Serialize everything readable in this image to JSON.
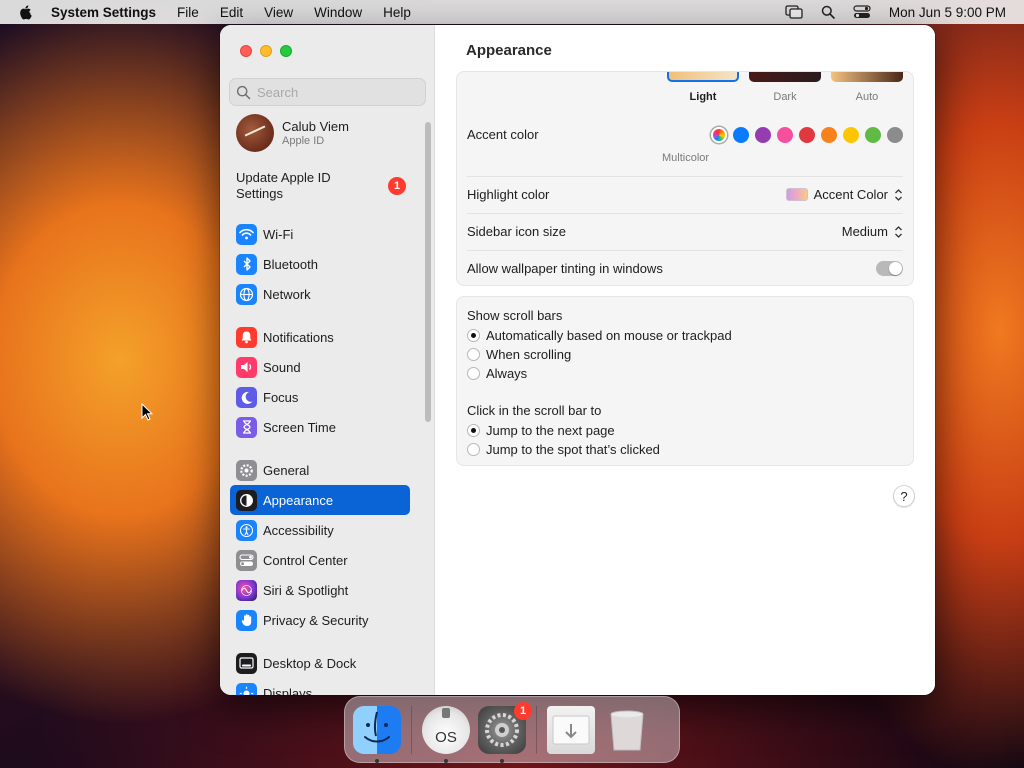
{
  "menubar": {
    "app_name": "System Settings",
    "menus": [
      "File",
      "Edit",
      "View",
      "Window",
      "Help"
    ],
    "icons": [
      "screen-mirroring-icon",
      "spotlight-search-icon",
      "control-center-icon"
    ],
    "clock": "Mon Jun 5  9:00 PM"
  },
  "sidebar": {
    "search_placeholder": "Search",
    "account": {
      "name": "Calub Viem",
      "subtitle": "Apple ID"
    },
    "update": {
      "label": "Update Apple ID Settings",
      "badge": "1"
    },
    "items": [
      {
        "label": "Wi-Fi",
        "icon": "wifi-icon",
        "color": "#1a84ff"
      },
      {
        "label": "Bluetooth",
        "icon": "bluetooth-icon",
        "color": "#1a84ff"
      },
      {
        "label": "Network",
        "icon": "globe-icon",
        "color": "#1a84ff"
      },
      {
        "label": "Notifications",
        "icon": "bell-icon",
        "color": "#ff3b30"
      },
      {
        "label": "Sound",
        "icon": "speaker-icon",
        "color": "#ff3b6b"
      },
      {
        "label": "Focus",
        "icon": "moon-icon",
        "color": "#5e5ce6"
      },
      {
        "label": "Screen Time",
        "icon": "hourglass-icon",
        "color": "#7b5ce6"
      },
      {
        "label": "General",
        "icon": "gear-icon",
        "color": "#8e8e93"
      },
      {
        "label": "Appearance",
        "icon": "appearance-icon",
        "color": "#1d1d1f"
      },
      {
        "label": "Accessibility",
        "icon": "accessibility-icon",
        "color": "#1a84ff"
      },
      {
        "label": "Control Center",
        "icon": "switches-icon",
        "color": "#8e8e93"
      },
      {
        "label": "Siri & Spotlight",
        "icon": "siri-icon",
        "color": "#b23ad6"
      },
      {
        "label": "Privacy & Security",
        "icon": "hand-icon",
        "color": "#1a84ff"
      },
      {
        "label": "Desktop & Dock",
        "icon": "dock-icon",
        "color": "#1d1d1f"
      },
      {
        "label": "Displays",
        "icon": "sun-icon",
        "color": "#1a84ff"
      }
    ],
    "active": "Appearance"
  },
  "content": {
    "title": "Appearance",
    "appearance_modes": [
      "Light",
      "Dark",
      "Auto"
    ],
    "selected_mode": "Light",
    "accent": {
      "label": "Accent color",
      "selected_label": "Multicolor",
      "colors": [
        "#f5a623",
        "#0a7aff",
        "#953daf",
        "#f74f9e",
        "#e0383e",
        "#f7821b",
        "#ffc600",
        "#62ba46",
        "#8c8c8c"
      ]
    },
    "highlight": {
      "label": "Highlight color",
      "value": "Accent Color"
    },
    "sidebar_icon": {
      "label": "Sidebar icon size",
      "value": "Medium"
    },
    "tinting": {
      "label": "Allow wallpaper tinting in windows",
      "enabled": false
    },
    "scroll_bars": {
      "label": "Show scroll bars",
      "options": [
        "Automatically based on mouse or trackpad",
        "When scrolling",
        "Always"
      ],
      "selected": "Automatically based on mouse or trackpad"
    },
    "click_scroll": {
      "label": "Click in the scroll bar to",
      "options": [
        "Jump to the next page",
        "Jump to the spot that’s clicked"
      ],
      "selected": "Jump to the next page"
    },
    "help": "?"
  },
  "dock": {
    "apps": [
      {
        "name": "Finder",
        "running": true
      },
      {
        "name": "macOS Installer",
        "running": true,
        "label": "OS"
      },
      {
        "name": "System Settings",
        "running": true,
        "badge": "1"
      },
      {
        "name": "Downloads"
      },
      {
        "name": "Trash"
      }
    ]
  }
}
